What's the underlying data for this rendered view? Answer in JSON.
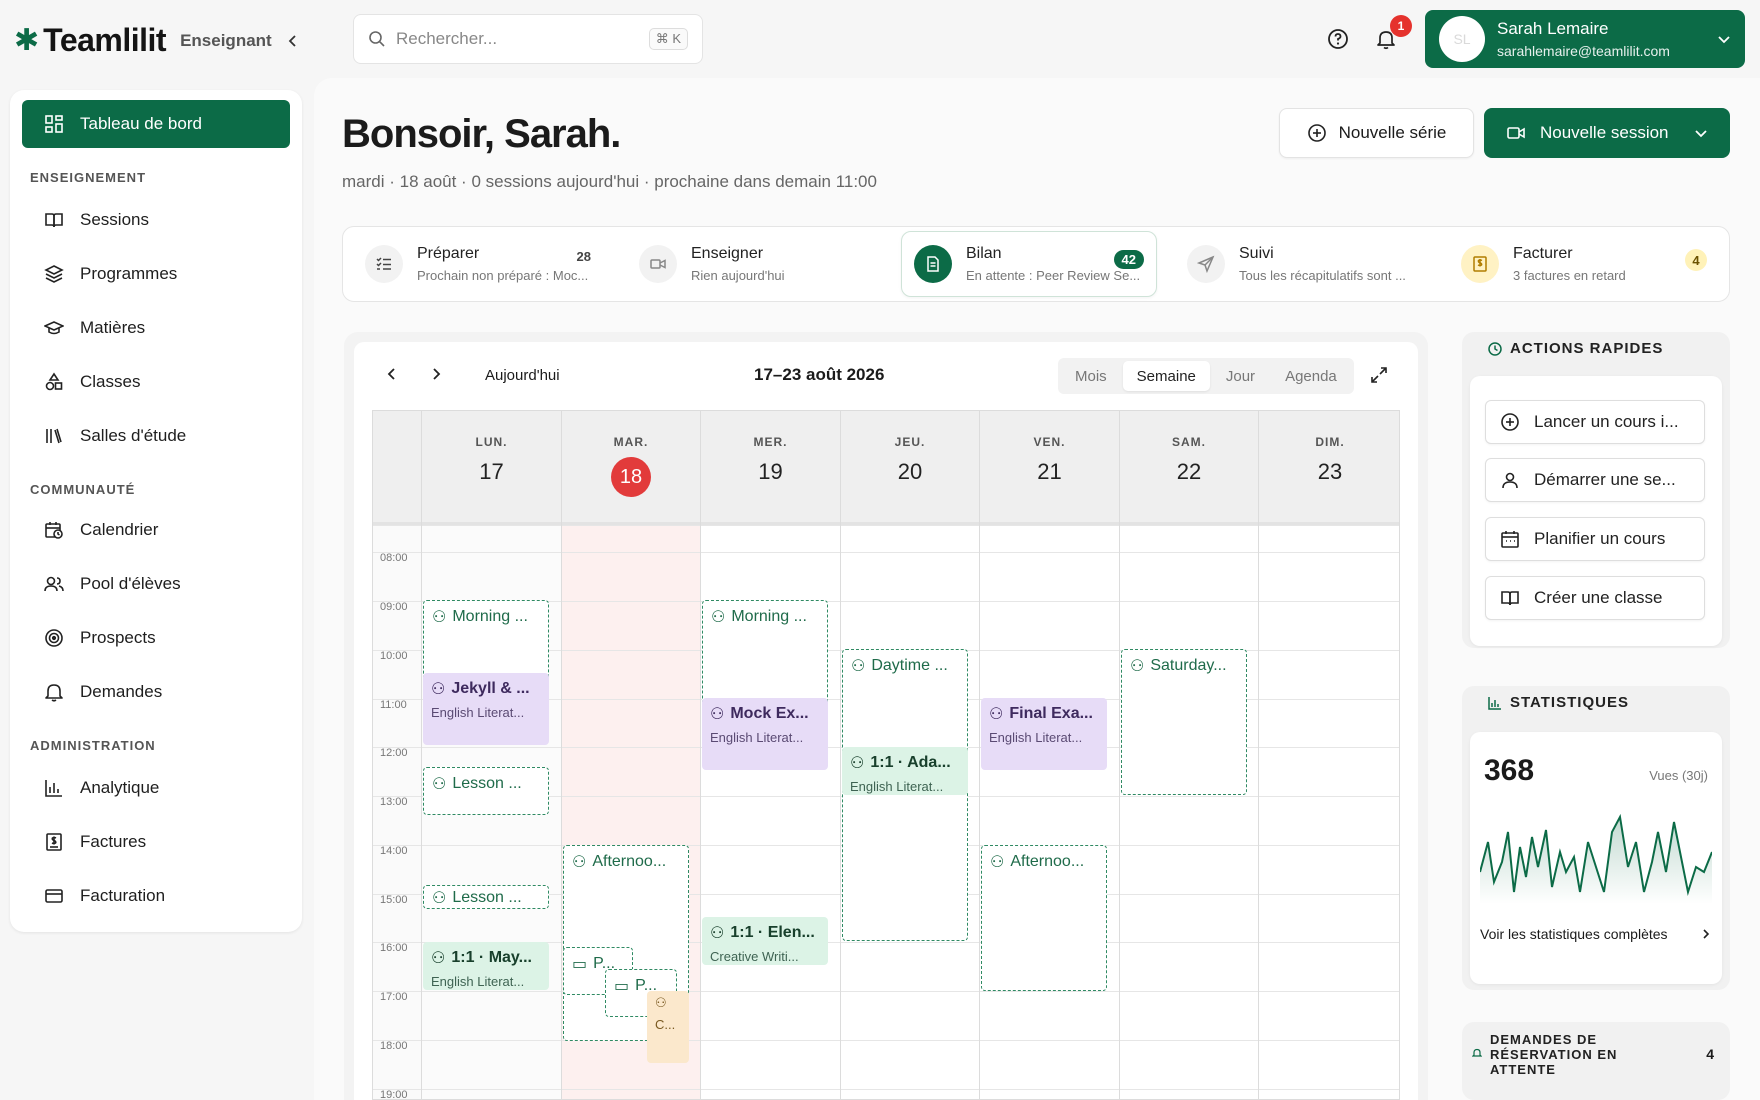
{
  "brand": {
    "name": "Teamlilit",
    "role": "Enseignant"
  },
  "search": {
    "placeholder": "Rechercher...",
    "shortcut": "⌘ K"
  },
  "notifications": {
    "count": "1"
  },
  "user": {
    "name": "Sarah Lemaire",
    "email": "sarahlemaire@teamlilit.com",
    "initials": "SL"
  },
  "sidebar": {
    "dashboard": "Tableau de bord",
    "sections": {
      "teaching": "ENSEIGNEMENT",
      "community": "COMMUNAUTÉ",
      "admin": "ADMINISTRATION"
    },
    "items": {
      "sessions": "Sessions",
      "programmes": "Programmes",
      "matieres": "Matières",
      "classes": "Classes",
      "salles": "Salles d'étude",
      "calendrier": "Calendrier",
      "pool": "Pool d'élèves",
      "prospects": "Prospects",
      "demandes": "Demandes",
      "analytique": "Analytique",
      "factures": "Factures",
      "facturation": "Facturation"
    }
  },
  "header": {
    "greeting": "Bonsoir, Sarah.",
    "subline": "mardi · 18 août · 0 sessions aujourd'hui · prochaine dans demain 11:00",
    "new_series": "Nouvelle série",
    "new_session": "Nouvelle session"
  },
  "workflow": [
    {
      "title": "Préparer",
      "sub": "Prochain non préparé : Moc...",
      "badge": "28"
    },
    {
      "title": "Enseigner",
      "sub": "Rien aujourd'hui",
      "badge": ""
    },
    {
      "title": "Bilan",
      "sub": "En attente : Peer Review Se...",
      "badge": "42"
    },
    {
      "title": "Suivi",
      "sub": "Tous les récapitulatifs sont ...",
      "badge": ""
    },
    {
      "title": "Facturer",
      "sub": "3 factures en retard",
      "badge": "4"
    }
  ],
  "calendar": {
    "today_btn": "Aujourd'hui",
    "range": "17–23 août 2026",
    "views": [
      "Mois",
      "Semaine",
      "Jour",
      "Agenda"
    ],
    "days": [
      {
        "name": "LUN.",
        "num": "17"
      },
      {
        "name": "MAR.",
        "num": "18"
      },
      {
        "name": "MER.",
        "num": "19"
      },
      {
        "name": "JEU.",
        "num": "20"
      },
      {
        "name": "VEN.",
        "num": "21"
      },
      {
        "name": "SAM.",
        "num": "22"
      },
      {
        "name": "DIM.",
        "num": "23"
      }
    ],
    "hours": [
      "08:00",
      "09:00",
      "10:00",
      "11:00",
      "12:00",
      "13:00",
      "14:00",
      "15:00",
      "16:00",
      "17:00",
      "18:00",
      "19:00"
    ],
    "events": {
      "mon_morning": "Morning ...",
      "mon_jekyll": "Jekyll & ...",
      "mon_jekyll_sub": "English Literat...",
      "mon_lesson1": "Lesson ...",
      "mon_lesson2": "Lesson ...",
      "mon_may": "1:1 · May...",
      "mon_may_sub": "English Literat...",
      "tue_afternoon": "Afternoo...",
      "tue_p1": "P...",
      "tue_p2": "P...",
      "tue_c": "C...",
      "wed_morning": "Morning ...",
      "wed_mock": "Mock Ex...",
      "wed_mock_sub": "English Literat...",
      "wed_elen": "1:1 · Elen...",
      "wed_elen_sub": "Creative Writi...",
      "thu_daytime": "Daytime ...",
      "thu_ada": "1:1 · Ada...",
      "thu_ada_sub": "English Literat...",
      "fri_final": "Final Exa...",
      "fri_final_sub": "English Literat...",
      "fri_afternoon": "Afternoo...",
      "sat_saturday": "Saturday..."
    }
  },
  "quick_actions": {
    "title": "ACTIONS RAPIDES",
    "items": [
      "Lancer un cours i...",
      "Démarrer une se...",
      "Planifier un cours",
      "Créer une classe"
    ]
  },
  "stats": {
    "title": "STATISTIQUES",
    "value": "368",
    "label": "Vues (30j)",
    "link": "Voir les statistiques complètes"
  },
  "pending": {
    "title": "DEMANDES DE RÉSERVATION EN ATTENTE",
    "count": "4"
  },
  "colors": {
    "brand": "#0c6b47",
    "today": "#e23b3b"
  }
}
